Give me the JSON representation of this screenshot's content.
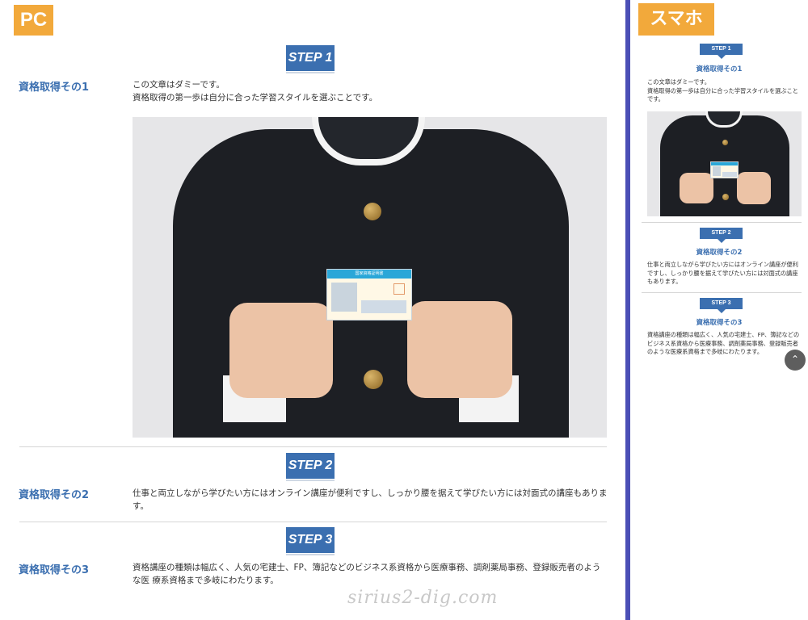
{
  "pc": {
    "label": "PC",
    "steps": [
      {
        "badge": "STEP 1",
        "heading": "資格取得その1",
        "text": "この文章はダミーです。\n資格取得の第一歩は自分に合った学習スタイルを選ぶことです。"
      },
      {
        "badge": "STEP 2",
        "heading": "資格取得その2",
        "text": "仕事と両立しながら学びたい方にはオンライン講座が便利ですし、しっかり腰を据えて学びたい方には対面式の講座もありま す。"
      },
      {
        "badge": "STEP 3",
        "heading": "資格取得その3",
        "text": "資格講座の種類は幅広く、人気の宅建士、FP、簿記などのビジネス系資格から医療事務、調剤薬局事務、登録販売者のような医 療系資格まで多岐にわたります。"
      }
    ],
    "card_title": "国家資格証明書"
  },
  "sp": {
    "label": "スマホ",
    "steps": [
      {
        "badge": "STEP 1",
        "heading": "資格取得その1",
        "text": "この文章はダミーです。\n資格取得の第一歩は自分に合った学習スタイルを選ぶことです。"
      },
      {
        "badge": "STEP 2",
        "heading": "資格取得その2",
        "text": "仕事と両立しながら学びたい方にはオンライン講座が便利ですし、しっかり腰を据えて学びたい方には対面式の講座もあります。"
      },
      {
        "badge": "STEP 3",
        "heading": "資格取得その3",
        "text": "資格講座の種類は幅広く、人気の宅建士、FP、簿記などのビジネス系資格から医療事務、調剤薬局事務、登録販売者のような医療系資格まで多岐にわたります。"
      }
    ],
    "scroll_icon": "chevron-up-icon"
  },
  "watermark": "sirius2-dig.com",
  "colors": {
    "accent": "#3b6fb0",
    "label_bg": "#f2a93b",
    "divider": "#4b4fb6"
  }
}
